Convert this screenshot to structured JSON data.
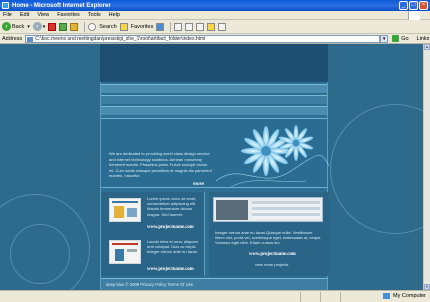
{
  "window": {
    "title": "Home - Microsoft Internet Explorer",
    "controls": [
      "_",
      "□",
      "×"
    ]
  },
  "menu": {
    "items": [
      "File",
      "Edit",
      "View",
      "Favorites",
      "Tools",
      "Help"
    ]
  },
  "toolbar": {
    "back_label": "Back",
    "search_label": "Search",
    "favorites_label": "Favorites"
  },
  "address": {
    "label": "Address",
    "url": "C:\\boc.meens and mettingdan\\presistigi_st\\e_1\\root\\artifact_folder\\index.html",
    "go_label": "Go",
    "links_label": "Links"
  },
  "page": {
    "hero_text": "We are dedicated to providing world class design service and internet technology solutions. Aenean nonummy hendrerit mauris. Phasellus porta. Fusce suscipit varius mi. Cum sociis natoque penatibus et magnis dis parturient montes, nascetur.",
    "hero_more": "more",
    "left_items": [
      {
        "text": "Lorem ipsum dolor sit amet, consectetuer adipiscing elit. Mauris fermentum dictum magna. Sed laoreet.",
        "link": "www.projectname.com"
      },
      {
        "text": "Lacotn tetur et urna, aliquam erat volutpat. Duis ac turpis. Integer rutrum ante eu lacus.",
        "link": "www.projectname.com"
      }
    ],
    "right_text": "Integer rutrum ante eu lacus.Quisque nulla. Vestibulum libero nisl, porta vel, scelerisque eget, malesuada at, neque. Vivamus eget nibh. Etiam cursus leo.",
    "right_link": "www.projectname.com",
    "right_sub": "view more projects",
    "footer": "deep blue © 2009 Privacy Policy Terms Of Use"
  },
  "status": {
    "zone": "My Computer"
  }
}
